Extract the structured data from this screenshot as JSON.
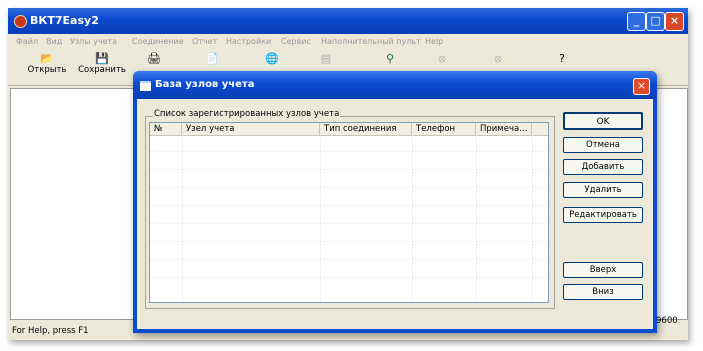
{
  "app": {
    "title": "ВКТ7Easy2",
    "window_buttons": [
      "_",
      "□",
      "×"
    ]
  },
  "menu": [
    "Файл",
    "Вид",
    "Узлы учета",
    "Соединение",
    "Отчет",
    "Настройки",
    "Сервис",
    "Наполнительный пульт",
    "Help"
  ],
  "toolbar": {
    "open_label": "Открыть",
    "save_label": "Сохранить"
  },
  "statusbar": {
    "text": "For Help, press F1",
    "value": "9600"
  },
  "dialog": {
    "title": "База узлов учета",
    "close": "×",
    "group_label": "Список зарегистрированных узлов учета",
    "columns": [
      "№",
      "Узел учета",
      "Тип соединения",
      "Телефон",
      "Примеча..."
    ],
    "buttons": {
      "ok": "OK",
      "cancel": "Отмена",
      "add": "Добавить",
      "delete": "Удалить",
      "edit": "Редактировать",
      "up": "Вверх",
      "down": "Вниз"
    }
  },
  "colors": {
    "titlebar": "#0b4bd0",
    "window_bg": "#ece9d8",
    "close_button": "#e04a2a"
  }
}
